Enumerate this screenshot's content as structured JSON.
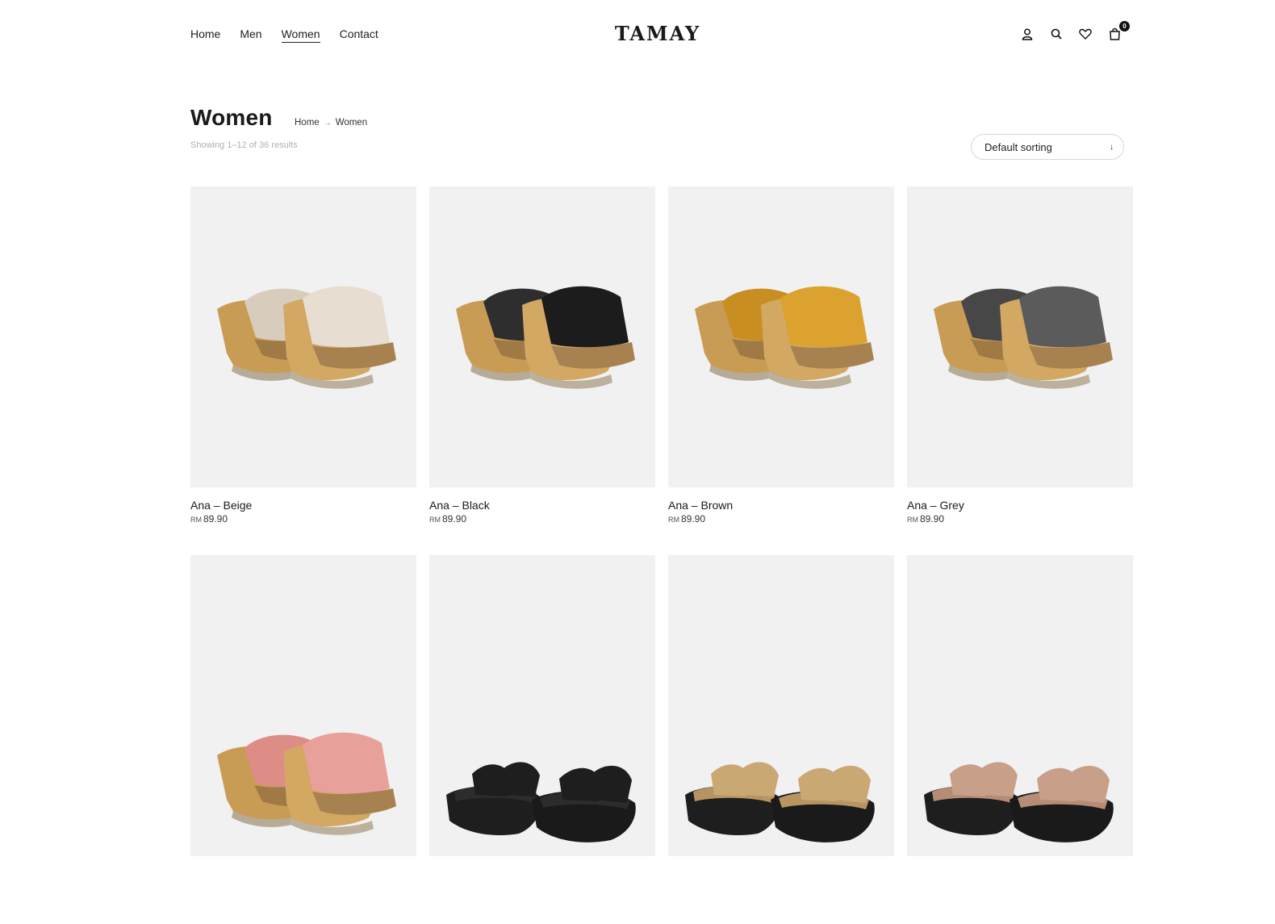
{
  "header": {
    "nav": [
      {
        "label": "Home",
        "active": false
      },
      {
        "label": "Men",
        "active": false
      },
      {
        "label": "Women",
        "active": true
      },
      {
        "label": "Contact",
        "active": false
      }
    ],
    "logo_text": "TAMAY",
    "cart_count": "0",
    "icons": [
      "user-icon",
      "search-icon",
      "heart-icon",
      "cart-icon"
    ]
  },
  "page": {
    "title": "Women",
    "breadcrumb": [
      "Home",
      "Women"
    ],
    "result_count": "Showing 1–12 of 36 results",
    "sort_label": "Default sorting"
  },
  "products": [
    {
      "name": "Ana – Beige",
      "currency": "RM",
      "price": "89.90",
      "style": "wedge",
      "color": "#e7ddd0",
      "accent": "#d8ccbc"
    },
    {
      "name": "Ana – Black",
      "currency": "RM",
      "price": "89.90",
      "style": "wedge",
      "color": "#1c1c1c",
      "accent": "#2e2e2e"
    },
    {
      "name": "Ana – Brown",
      "currency": "RM",
      "price": "89.90",
      "style": "wedge",
      "color": "#dba230",
      "accent": "#c98e22"
    },
    {
      "name": "Ana – Grey",
      "currency": "RM",
      "price": "89.90",
      "style": "wedge",
      "color": "#5b5b5b",
      "accent": "#474747"
    },
    {
      "name": "",
      "currency": "",
      "price": "",
      "style": "wedge",
      "color": "#e8a09a",
      "accent": "#dd8c86"
    },
    {
      "name": "",
      "currency": "",
      "price": "",
      "style": "flat",
      "color": "#1e1e1e",
      "accent": "#2c2c2c"
    },
    {
      "name": "",
      "currency": "",
      "price": "",
      "style": "flat",
      "color": "#c9a874",
      "accent": "#b89463"
    },
    {
      "name": "",
      "currency": "",
      "price": "",
      "style": "flat",
      "color": "#c8a08a",
      "accent": "#b68c77"
    }
  ]
}
